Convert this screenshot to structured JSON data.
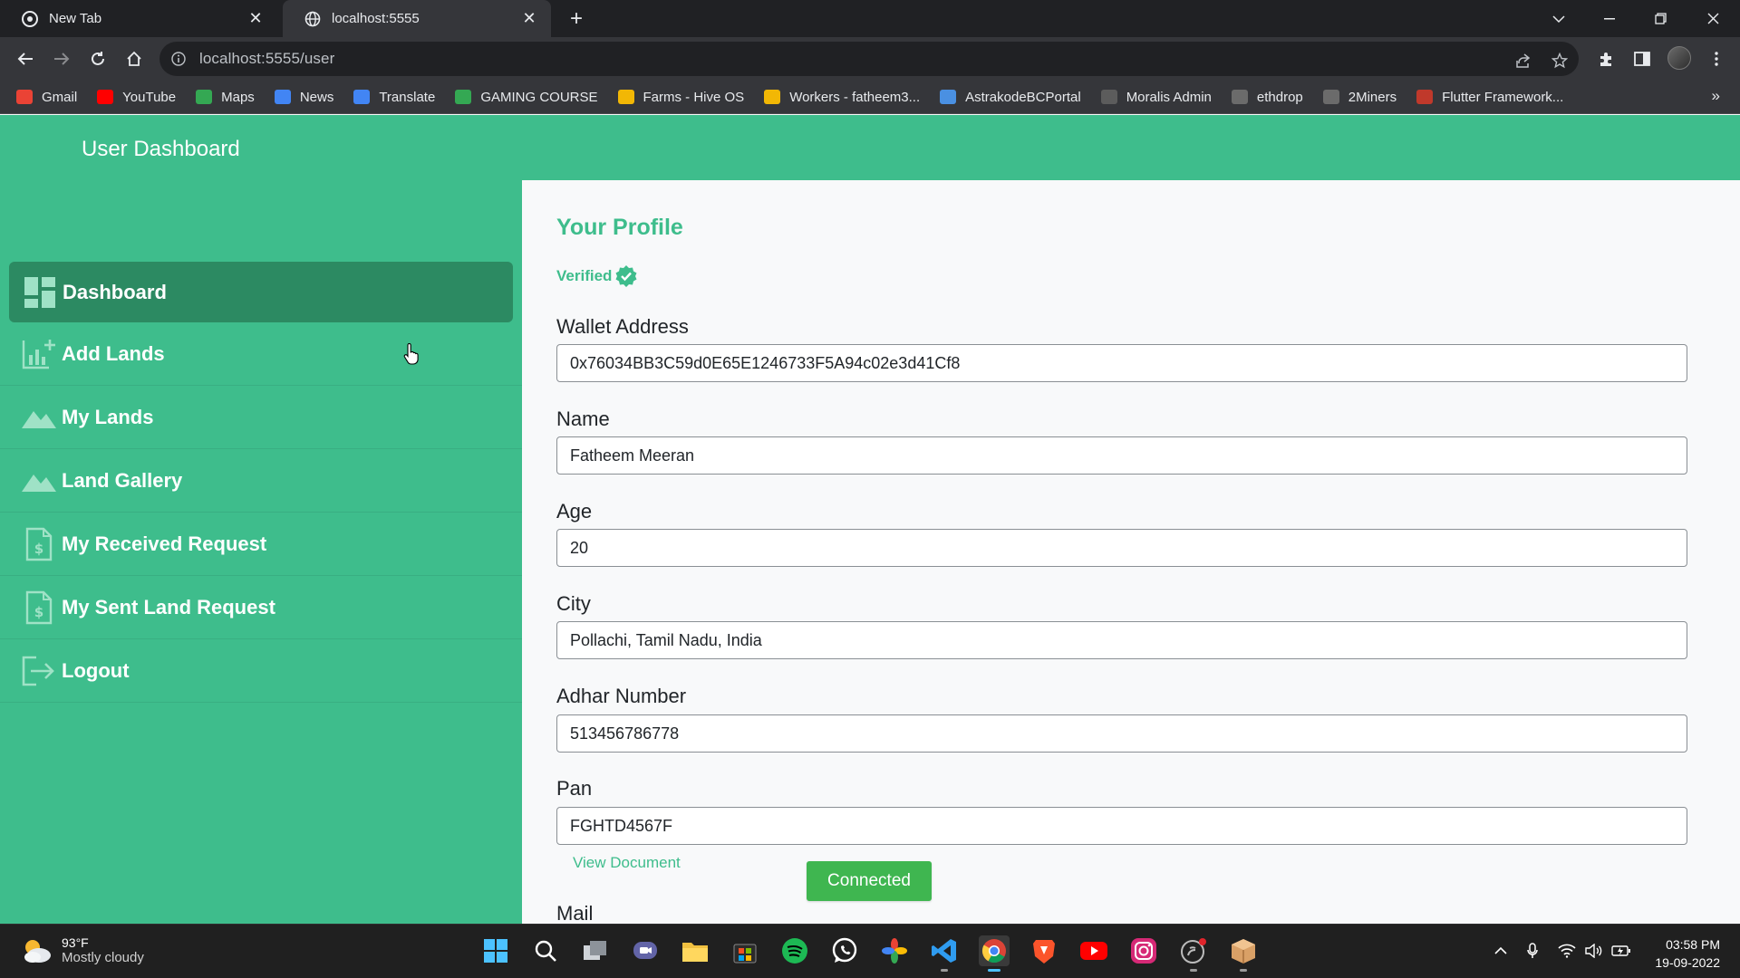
{
  "browser": {
    "tabs": [
      {
        "title": "New Tab",
        "active": false
      },
      {
        "title": "localhost:5555",
        "active": true
      }
    ],
    "url": "localhost:5555/user",
    "bookmarks": [
      {
        "label": "Gmail",
        "icon": "gmail-icon",
        "color": "#ea4335"
      },
      {
        "label": "YouTube",
        "icon": "youtube-icon",
        "color": "#ff0000"
      },
      {
        "label": "Maps",
        "icon": "maps-icon",
        "color": "#34a853"
      },
      {
        "label": "News",
        "icon": "news-icon",
        "color": "#4285f4"
      },
      {
        "label": "Translate",
        "icon": "translate-icon",
        "color": "#4285f4"
      },
      {
        "label": "GAMING COURSE",
        "icon": "chart-icon",
        "color": "#34a853"
      },
      {
        "label": "Farms - Hive OS",
        "icon": "hiveos-icon",
        "color": "#f2b705"
      },
      {
        "label": "Workers - fatheem3...",
        "icon": "hiveos-icon",
        "color": "#f2b705"
      },
      {
        "label": "AstrakodeBCPortal",
        "icon": "link-icon",
        "color": "#4a90e2"
      },
      {
        "label": "Moralis Admin",
        "icon": "moralis-icon",
        "color": "#5c5c5c"
      },
      {
        "label": "ethdrop",
        "icon": "ethereum-icon",
        "color": "#6b6b6b"
      },
      {
        "label": "2Miners",
        "icon": "2miners-icon",
        "color": "#6b6b6b"
      },
      {
        "label": "Flutter Framework...",
        "icon": "flutter-icon",
        "color": "#c0392b"
      }
    ]
  },
  "app": {
    "title": "User Dashboard",
    "accent": "#3ebd8c",
    "active_nav": "#2c8a62"
  },
  "sidebar": {
    "items": [
      {
        "label": "Dashboard",
        "icon": "dashboard-icon",
        "active": true
      },
      {
        "label": "Add Lands",
        "icon": "add-chart-icon",
        "active": false
      },
      {
        "label": "My Lands",
        "icon": "mountain-icon",
        "active": false
      },
      {
        "label": "Land Gallery",
        "icon": "mountain-icon",
        "active": false
      },
      {
        "label": "My Received Request",
        "icon": "dollar-document-icon",
        "active": false
      },
      {
        "label": "My Sent Land Request",
        "icon": "dollar-document-icon",
        "active": false
      },
      {
        "label": "Logout",
        "icon": "logout-icon",
        "active": false
      }
    ]
  },
  "profile": {
    "title": "Your Profile",
    "verified_label": "Verified",
    "fields": [
      {
        "label": "Wallet Address",
        "value": "0x76034BB3C59d0E65E1246733F5A94c02e3d41Cf8"
      },
      {
        "label": "Name",
        "value": "Fatheem Meeran"
      },
      {
        "label": "Age",
        "value": "20"
      },
      {
        "label": "City",
        "value": "Pollachi, Tamil Nadu, India"
      },
      {
        "label": "Adhar Number",
        "value": "513456786778"
      },
      {
        "label": "Pan",
        "value": "FGHTD4567F"
      }
    ],
    "view_document": "View Document",
    "connected_button": "Connected",
    "mail_label": "Mail"
  },
  "taskbar": {
    "weather_temp": "93°F",
    "weather_desc": "Mostly cloudy",
    "time": "03:58 PM",
    "date": "19-09-2022"
  }
}
